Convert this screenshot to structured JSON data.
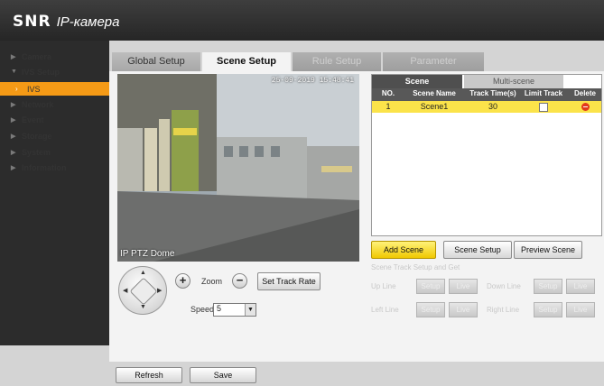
{
  "brand": {
    "logo": "SNR",
    "product": "IP-камера"
  },
  "sidebar": {
    "items": [
      {
        "label": "Camera"
      },
      {
        "label": "IVS Setup"
      },
      {
        "label": "IVS"
      },
      {
        "label": "Network"
      },
      {
        "label": "Event"
      },
      {
        "label": "Storage"
      },
      {
        "label": "System"
      },
      {
        "label": "Information"
      }
    ]
  },
  "tabs": [
    {
      "label": "Global Setup",
      "state": "normal"
    },
    {
      "label": "Scene Setup",
      "state": "active"
    },
    {
      "label": "Rule Setup",
      "state": "disabled"
    },
    {
      "label": "Parameter",
      "state": "disabled"
    }
  ],
  "video": {
    "timestamp": "25-09-2019 15:48:41",
    "channel_name": "IP PTZ Dome"
  },
  "ptz": {
    "zoom_label": "Zoom",
    "zoom_in": "+",
    "zoom_out": "−",
    "track_rate_button": "Set Track Rate",
    "speed_label": "Speed",
    "speed_value": "5"
  },
  "scene_table": {
    "subtabs": [
      "Scene",
      "Multi-scene"
    ],
    "columns": [
      "NO.",
      "Scene Name",
      "Track Time(s)",
      "Limit Track",
      "Delete"
    ],
    "rows": [
      {
        "no": "1",
        "name": "Scene1",
        "track_time": "30",
        "limit_track": false
      }
    ]
  },
  "scene_buttons": {
    "add": "Add Scene",
    "setup": "Scene Setup",
    "preview": "Preview Scene"
  },
  "track": {
    "title": "Scene Track Setup and Get",
    "up_line": "Up Line",
    "down_line": "Down Line",
    "left_line": "Left Line",
    "right_line": "Right Line",
    "setup": "Setup",
    "live": "Live"
  },
  "footer": {
    "refresh": "Refresh",
    "save": "Save"
  },
  "colors": {
    "accent": "#f59a16",
    "selected_row": "#fbe34a",
    "header": "#2b2b2b"
  }
}
